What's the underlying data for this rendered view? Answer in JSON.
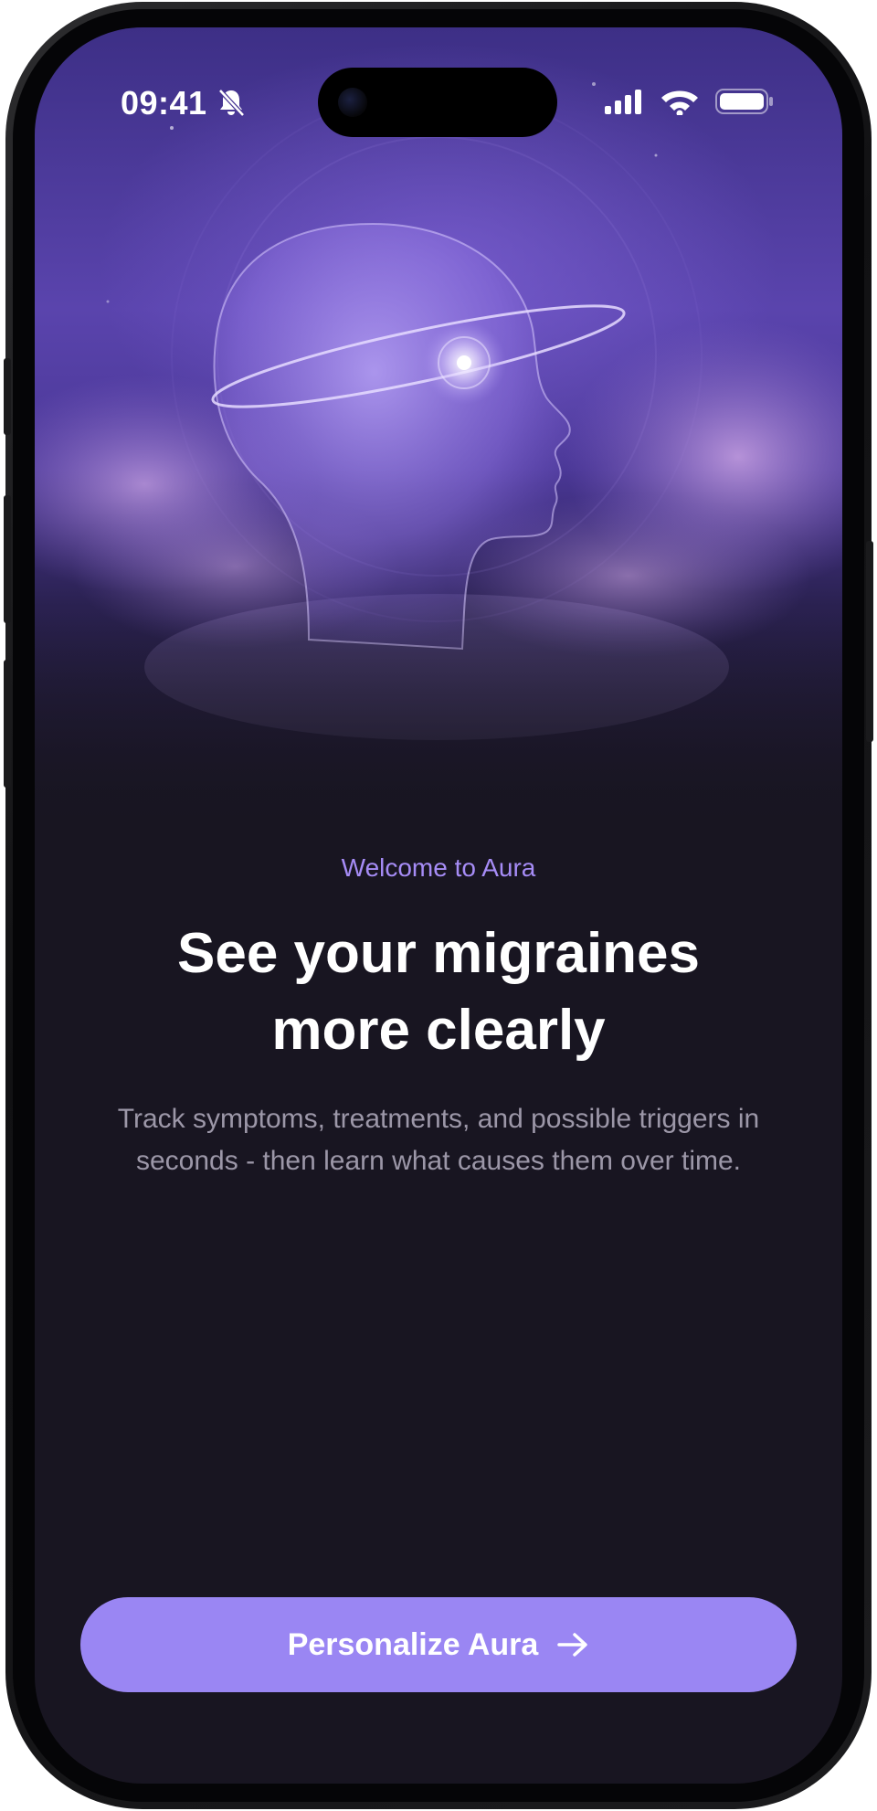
{
  "status_bar": {
    "time": "09:41",
    "icons": [
      "bell-slash-icon",
      "cellular-signal-icon",
      "wifi-icon",
      "battery-icon"
    ]
  },
  "hero": {
    "illustration": "head-with-orbit-illustration"
  },
  "onboarding": {
    "eyebrow": "Welcome to Aura",
    "headline": "See your migraines more clearly",
    "subtitle": "Track symptoms, treatments, and possible triggers in seconds - then learn what causes them over time."
  },
  "cta": {
    "label": "Personalize Aura",
    "icon": "arrow-right-icon"
  },
  "colors": {
    "accent": "#9a86f3",
    "eyebrow": "#a68cf6",
    "background": "#181521",
    "subtitle": "#9c97a8"
  }
}
